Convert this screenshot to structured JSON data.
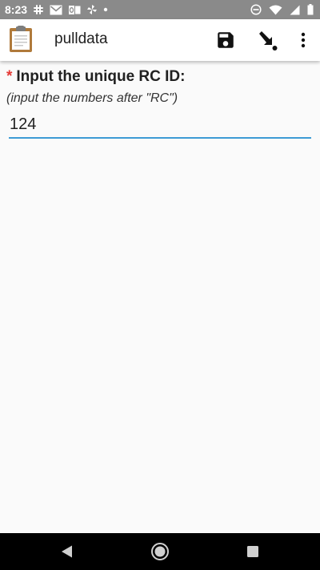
{
  "status_bar": {
    "time": "8:23",
    "left_icons": [
      "slack-icon",
      "gmail-icon",
      "outlook-icon",
      "pinwheel-icon",
      "dot-icon"
    ],
    "right_icons": [
      "do-not-disturb-icon",
      "wifi-icon",
      "signal-icon",
      "battery-icon"
    ]
  },
  "app_bar": {
    "app_icon": "clipboard-icon",
    "title": "pulldata",
    "actions": [
      "save-icon",
      "go-to-prompt-icon",
      "overflow-menu-icon"
    ]
  },
  "question": {
    "required_marker": "*",
    "label": "Input the unique RC ID:",
    "hint": "(input the numbers after \"RC\")",
    "answer_value": "124"
  },
  "nav_bar": {
    "buttons": [
      "back-icon",
      "home-icon",
      "recents-icon"
    ]
  },
  "colors": {
    "status_bar": "#8a8a8a",
    "app_bar": "#ffffff",
    "background": "#fafafa",
    "required": "#e53935",
    "input_underline": "#3d9bd5",
    "nav_bar": "#000000"
  }
}
